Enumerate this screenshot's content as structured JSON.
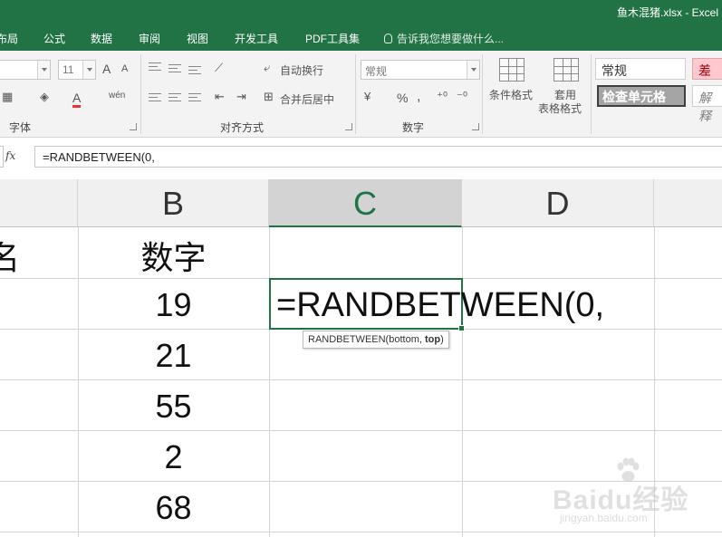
{
  "window": {
    "title": "鱼木混猪.xlsx - Excel"
  },
  "menu": {
    "items": [
      "布局",
      "公式",
      "数据",
      "审阅",
      "视图",
      "开发工具",
      "PDF工具集"
    ],
    "tell_me": "告诉我您想要做什么..."
  },
  "ribbon": {
    "font_size": "11",
    "grow_font": "A",
    "shrink_font": "A",
    "font_color": "A",
    "wen": "wén",
    "wrap_text": "自动换行",
    "merge_center": "合并后居中",
    "number_format": "常规",
    "percent": "%",
    "comma": ",",
    "conditional_format": "条件格式",
    "table_format_1": "套用",
    "table_format_2": "表格格式",
    "groups": {
      "font": "字体",
      "alignment": "对齐方式",
      "number": "数字"
    },
    "styles": {
      "normal": "常规",
      "bad": "差",
      "check_cell": "检查单元格",
      "explanatory": "解释"
    }
  },
  "formula_bar": {
    "fx": "fx",
    "value": "=RANDBETWEEN(0,"
  },
  "sheet": {
    "columns": [
      "B",
      "C",
      "D"
    ],
    "active_column": "C",
    "col_a_header_partial": "名",
    "col_b_header": "数字",
    "col_b_values": [
      "19",
      "21",
      "55",
      "2",
      "68"
    ],
    "active_cell_text": "=RANDBETWEEN(0,",
    "tooltip": {
      "func": "RANDBETWEEN(",
      "arg1": "bottom, ",
      "arg2": "top",
      "close": ")"
    }
  },
  "watermark": {
    "main": "Baidu经验",
    "sub": "jingyan.baidu.com"
  },
  "colors": {
    "excel_green": "#217346",
    "selection_header": "#d3d3d3"
  }
}
